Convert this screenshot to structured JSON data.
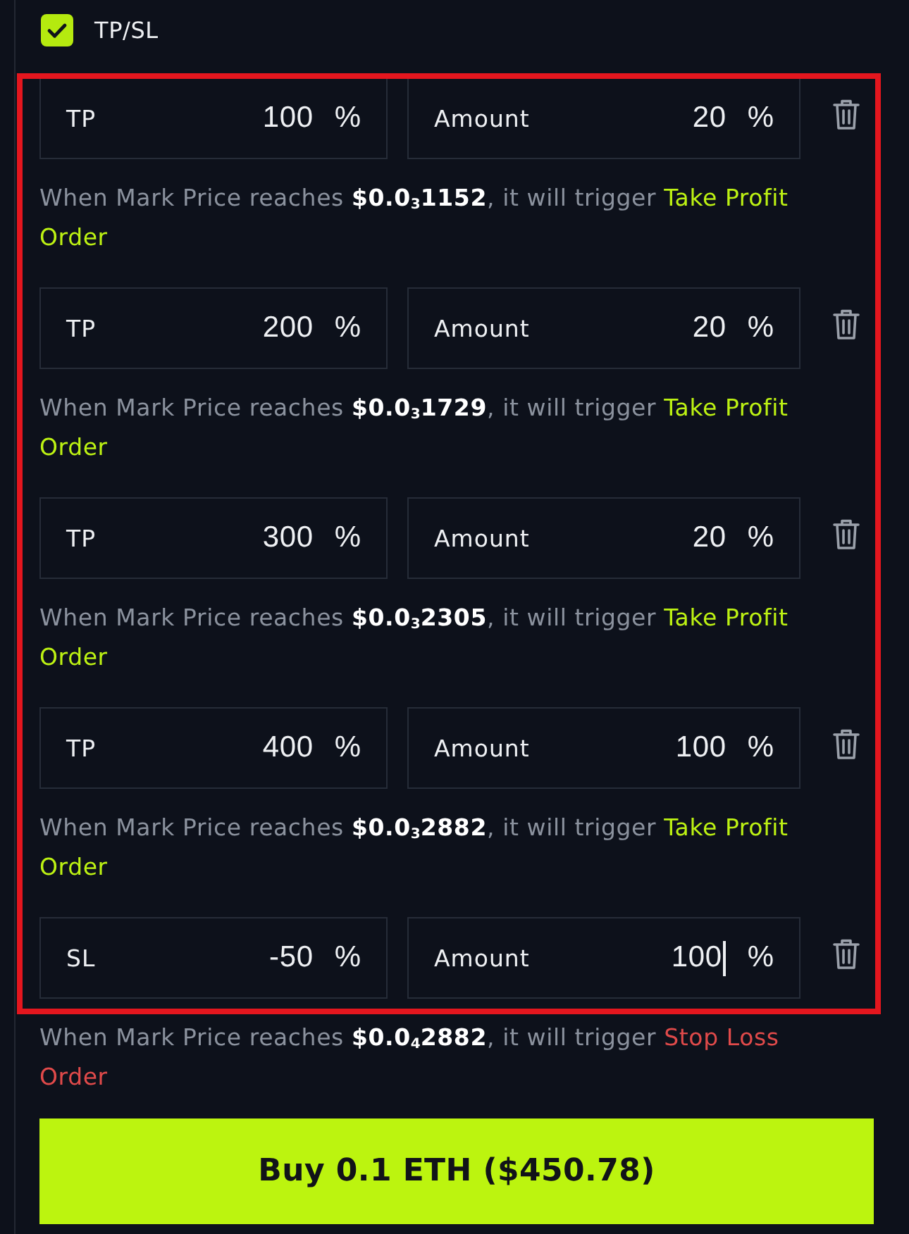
{
  "tpsl": {
    "label": "TP/SL",
    "checked": true
  },
  "orders": [
    {
      "kind": "take_profit",
      "highlighted": true,
      "trigger": {
        "label": "TP",
        "value": "100",
        "unit": "%"
      },
      "amount": {
        "label": "Amount",
        "value": "20",
        "unit": "%",
        "focused": false
      },
      "note": "When Mark Price reaches **$0.0**$_{3}$**1152**, it will trigger",
      "action": "Take Profit Order"
    },
    {
      "kind": "take_profit",
      "highlighted": true,
      "trigger": {
        "label": "TP",
        "value": "200",
        "unit": "%"
      },
      "amount": {
        "label": "Amount",
        "value": "20",
        "unit": "%",
        "focused": false
      },
      "note": "When Mark Price reaches **$0.0**$_{3}$**1729**, it will trigger",
      "action": "Take Profit Order"
    },
    {
      "kind": "take_profit",
      "highlighted": true,
      "trigger": {
        "label": "TP",
        "value": "300",
        "unit": "%"
      },
      "amount": {
        "label": "Amount",
        "value": "20",
        "unit": "%",
        "focused": false
      },
      "note": "When Mark Price reaches **$0.0**$_{3}$**2305**, it will trigger",
      "action": "Take Profit Order"
    },
    {
      "kind": "take_profit",
      "highlighted": true,
      "trigger": {
        "label": "TP",
        "value": "400",
        "unit": "%"
      },
      "amount": {
        "label": "Amount",
        "value": "100",
        "unit": "%",
        "focused": false
      },
      "note": "When Mark Price reaches **$0.0**$_{3}$**2882**, it will trigger",
      "action": "Take Profit Order"
    },
    {
      "kind": "stop_loss",
      "highlighted": true,
      "trigger": {
        "label": "SL",
        "value": "-50",
        "unit": "%"
      },
      "amount": {
        "label": "Amount",
        "value": "100",
        "unit": "%",
        "focused": true
      },
      "note": "When Mark Price reaches **$0.0**$_{4}$**2882**, it will trigger",
      "action": "Stop Loss Order"
    }
  ],
  "buy_button": {
    "label": "Buy 0.1 ETH ($450.78)"
  }
}
